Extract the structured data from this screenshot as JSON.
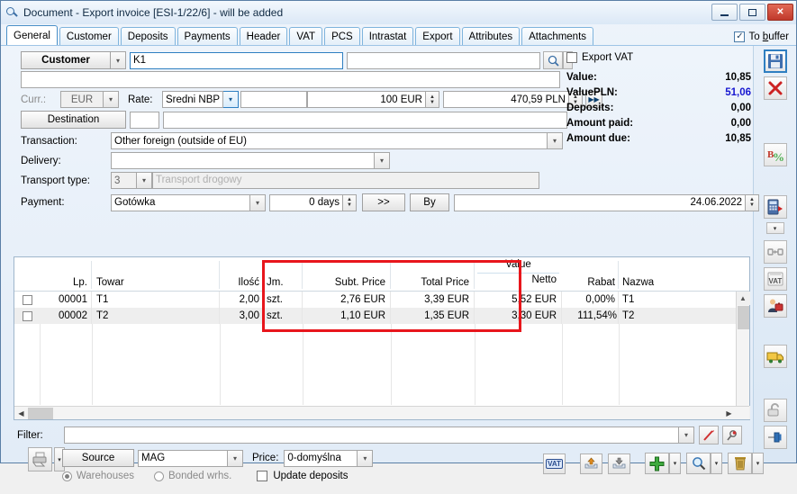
{
  "window": {
    "title": "Document - Export invoice [ESI-1/22/6]  - will be added",
    "icon": "document-search-icon",
    "minimize_label": "",
    "maximize_label": "",
    "close_label": "✕"
  },
  "tabs": [
    {
      "label": "General",
      "active": true
    },
    {
      "label": "Customer",
      "active": false
    },
    {
      "label": "Deposits",
      "active": false
    },
    {
      "label": "Payments",
      "active": false
    },
    {
      "label": "Header",
      "active": false
    },
    {
      "label": "VAT",
      "active": false
    },
    {
      "label": "PCS",
      "active": false
    },
    {
      "label": "Intrastat",
      "active": false
    },
    {
      "label": "Export",
      "active": false
    },
    {
      "label": "Attributes",
      "active": false
    },
    {
      "label": "Attachments",
      "active": false
    }
  ],
  "to_buffer": {
    "label_a": "To ",
    "label_b": "b",
    "label_c": "uffer",
    "checked": "✓"
  },
  "form": {
    "customer_button": "Customer",
    "customer_code": "K1",
    "customer_name": "",
    "customer_search_field": "",
    "address_line": "",
    "curr_label": "Curr.:",
    "curr_value": "EUR",
    "rate_label": "Rate:",
    "rate_type": "Średni NBP",
    "rate_name": "",
    "rate_from": "100 EUR",
    "rate_to": "470,59 PLN",
    "destination_button": "Destination",
    "destination_code": "",
    "destination_name": "",
    "transaction_label": "Transaction:",
    "transaction_value": "Other foreign (outside of EU)",
    "delivery_label": "Delivery:",
    "delivery_value": "",
    "transport_label": "Transport type:",
    "transport_code": "3",
    "transport_name": "Transport drogowy",
    "payment_label": "Payment:",
    "payment_value": "Gotówka",
    "payment_days": "0 days",
    "payment_more": ">>",
    "payment_by": "By",
    "payment_by_value": "",
    "payment_date": "24.06.2022"
  },
  "summary": {
    "export_vat_label": "Export VAT",
    "export_vat_checked": false,
    "rows": [
      {
        "label": "Value:",
        "value": "10,85",
        "blue": false
      },
      {
        "label": "ValuePLN:",
        "value": "51,06",
        "blue": true
      },
      {
        "label": "Deposits:",
        "value": "0,00",
        "blue": false
      },
      {
        "label": "Amount paid:",
        "value": "0,00",
        "blue": false
      },
      {
        "label": "Amount due:",
        "value": "10,85",
        "blue": false
      }
    ]
  },
  "grid": {
    "columns": [
      {
        "key": "chk",
        "label": "",
        "width": 28,
        "align": "center"
      },
      {
        "key": "lp",
        "label": "Lp.",
        "width": 58,
        "align": "right"
      },
      {
        "key": "towar",
        "label": "Towar",
        "width": 142,
        "align": "left"
      },
      {
        "key": "ilosc",
        "label": "Ilość",
        "width": 48,
        "align": "right"
      },
      {
        "key": "jm",
        "label": "Jm.",
        "width": 44,
        "align": "left"
      },
      {
        "key": "subt",
        "label": "Subt. Price",
        "width": 98,
        "align": "right"
      },
      {
        "key": "total",
        "label": "Total Price",
        "width": 93,
        "align": "right"
      },
      {
        "key": "netto",
        "label": "Value",
        "label2": "Netto",
        "width": 97,
        "align": "right"
      },
      {
        "key": "rabat",
        "label": "Rabat",
        "width": 63,
        "align": "right"
      },
      {
        "key": "nazwa",
        "label": "Nazwa",
        "width": 130,
        "align": "left"
      }
    ],
    "rows": [
      {
        "chk": "",
        "lp": "00001",
        "towar": "T1",
        "ilosc": "2,00",
        "jm": "szt.",
        "subt": "2,76 EUR",
        "total": "3,39 EUR",
        "netto": "5,52 EUR",
        "rabat": "0,00%",
        "nazwa": "T1"
      },
      {
        "chk": "",
        "lp": "00002",
        "towar": "T2",
        "ilosc": "3,00",
        "jm": "szt.",
        "subt": "1,10 EUR",
        "total": "1,35 EUR",
        "netto": "3,30 EUR",
        "rabat": "111,54%",
        "nazwa": "T2"
      }
    ]
  },
  "highlight": {
    "color": "#e8161c",
    "name": "price-columns-highlight"
  },
  "bottom": {
    "filter_label": "Filter:",
    "filter_value": "",
    "source_button": "Source",
    "source_value": "MAG",
    "price_label": "Price:",
    "price_value": "0-domyślna",
    "warehouses_label": "Warehouses",
    "bonded_label": "Bonded wrhs.",
    "warehouses_selected": true,
    "update_deposits_label": "Update deposits",
    "update_deposits_checked": false
  },
  "actions": [
    {
      "name": "vat-button",
      "glyph": "VAT"
    },
    {
      "name": "upload-button",
      "glyph": "▲"
    },
    {
      "name": "download-button",
      "glyph": "▼"
    },
    {
      "name": "add-button",
      "glyph": "+"
    },
    {
      "name": "search-button",
      "glyph": "search"
    },
    {
      "name": "delete-button",
      "glyph": "trash"
    }
  ],
  "toolbar": [
    {
      "name": "save-button",
      "glyph": "save",
      "selected": true
    },
    {
      "name": "cancel-button",
      "glyph": "close"
    },
    {
      "name": "discount-button",
      "glyph": "percent"
    },
    {
      "name": "calculator-button",
      "glyph": "calculator"
    },
    {
      "name": "link-button",
      "glyph": "link"
    },
    {
      "name": "vat-register-button",
      "glyph": "vat"
    },
    {
      "name": "contractor-button",
      "glyph": "person"
    },
    {
      "name": "shipment-button",
      "glyph": "truck"
    },
    {
      "name": "lock-button",
      "glyph": "lock"
    },
    {
      "name": "pin-button",
      "glyph": "pin"
    }
  ]
}
